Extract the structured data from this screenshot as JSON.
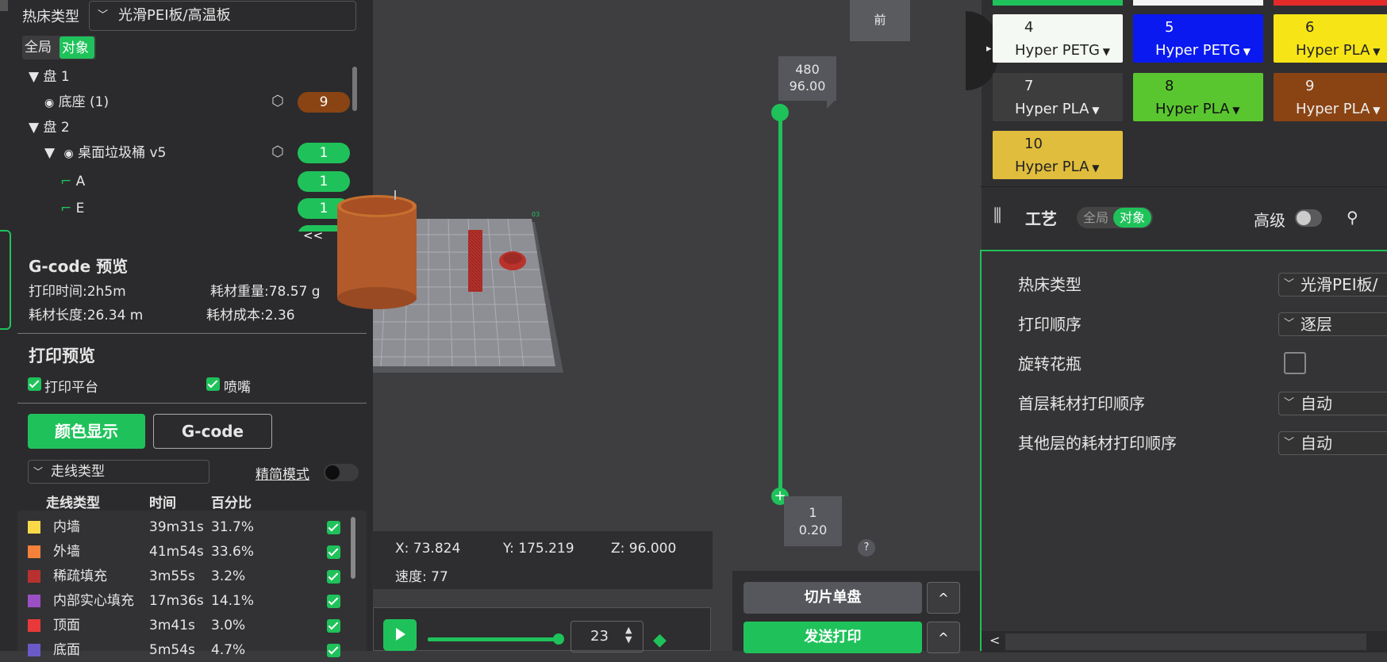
{
  "left": {
    "bed_label": "热床类型",
    "bed_value": "光滑PEI板/高温板",
    "scope": {
      "global": "全局",
      "object": "对象"
    },
    "tree": [
      {
        "label": "▼ 盘 1"
      },
      {
        "label": "底座 (1)",
        "badge": "9"
      },
      {
        "label": "▼ 盘 2"
      },
      {
        "label": "▼",
        "label2": "桌面垃圾桶 v5",
        "badge": "1"
      },
      {
        "label": "A",
        "badge": "1"
      },
      {
        "label": "E",
        "badge": "1"
      }
    ],
    "gcode": {
      "title": "G-code 预览",
      "time": "打印时间:2h5m",
      "weight": "耗材重量:78.57 g",
      "length": "耗材长度:26.34 m",
      "cost": "耗材成本:2.36"
    },
    "preview": {
      "title": "打印预览",
      "opt1": "打印平台",
      "opt2": "喷嘴",
      "btn_color": "颜色显示",
      "btn_gcode": "G-code",
      "line_type_select": "走线类型",
      "simple_mode": "精简模式"
    },
    "table": {
      "headers": [
        "走线类型",
        "时间",
        "百分比"
      ],
      "rows": [
        {
          "name": "内墙",
          "time": "39m31s",
          "pct": "31.7%",
          "color": "#f9d94a"
        },
        {
          "name": "外墙",
          "time": "41m54s",
          "pct": "33.6%",
          "color": "#f5823a"
        },
        {
          "name": "稀疏填充",
          "time": "3m55s",
          "pct": "3.2%",
          "color": "#b8312f"
        },
        {
          "name": "内部实心填充",
          "time": "17m36s",
          "pct": "14.1%",
          "color": "#9b4fc4"
        },
        {
          "name": "顶面",
          "time": "3m41s",
          "pct": "3.0%",
          "color": "#e83a3a"
        },
        {
          "name": "底面",
          "time": "5m54s",
          "pct": "4.7%",
          "color": "#6a5ac8"
        }
      ]
    }
  },
  "viewport": {
    "view_button": "前",
    "collapse": "<<",
    "plate_number": "03",
    "slider_top": {
      "layer": "480",
      "height": "96.00"
    },
    "slider_bottom": {
      "layer": "1",
      "height": "0.20"
    },
    "help": "?",
    "coords": {
      "x": "X: 73.824",
      "y": "Y: 175.219",
      "z": "Z: 96.000",
      "speed": "速度: 77"
    },
    "playback_value": "23",
    "slice_btn": "切片单盘",
    "send_btn": "发送打印",
    "caret": "^"
  },
  "right": {
    "filaments": [
      {
        "num": "4",
        "name": "Hyper PETG",
        "bg": "#f5f9f3",
        "fg": "#222"
      },
      {
        "num": "5",
        "name": "Hyper PETG",
        "bg": "#0a19f0",
        "fg": "#fff"
      },
      {
        "num": "6",
        "name": "Hyper PLA",
        "bg": "#f7e417",
        "fg": "#222"
      },
      {
        "num": "7",
        "name": "Hyper PLA",
        "bg": "#3d3d3d",
        "fg": "#eee"
      },
      {
        "num": "8",
        "name": "Hyper PLA",
        "bg": "#5ac62f",
        "fg": "#111"
      },
      {
        "num": "9",
        "name": "Hyper PLA",
        "bg": "#8a4413",
        "fg": "#eee"
      },
      {
        "num": "10",
        "name": "Hyper PLA",
        "bg": "#e0bd3c",
        "fg": "#222"
      }
    ],
    "process_title": "工艺",
    "scope": {
      "global": "全局",
      "object": "对象"
    },
    "advanced": "高级",
    "settings": [
      {
        "label": "热床类型",
        "value": "光滑PEI板/"
      },
      {
        "label": "打印顺序",
        "value": "逐层"
      },
      {
        "label": "旋转花瓶",
        "value": ""
      },
      {
        "label": "首层耗材打印顺序",
        "value": "自动"
      },
      {
        "label": "其他层的耗材打印顺序",
        "value": "自动"
      }
    ],
    "scroll_left": "<"
  }
}
